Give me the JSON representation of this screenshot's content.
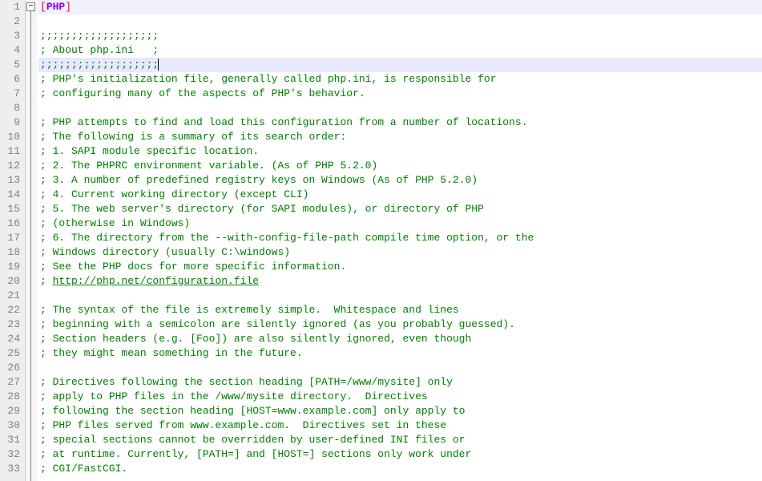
{
  "editor": {
    "fold_marker": "−",
    "current_line": 5,
    "lines": [
      {
        "num": 1,
        "type": "section",
        "text": "[PHP]"
      },
      {
        "num": 2,
        "type": "blank",
        "text": ""
      },
      {
        "num": 3,
        "type": "comment",
        "text": ";;;;;;;;;;;;;;;;;;;"
      },
      {
        "num": 4,
        "type": "comment",
        "text": "; About php.ini   ;"
      },
      {
        "num": 5,
        "type": "comment",
        "text": ";;;;;;;;;;;;;;;;;;;"
      },
      {
        "num": 6,
        "type": "comment",
        "text": "; PHP's initialization file, generally called php.ini, is responsible for"
      },
      {
        "num": 7,
        "type": "comment",
        "text": "; configuring many of the aspects of PHP's behavior."
      },
      {
        "num": 8,
        "type": "blank",
        "text": ""
      },
      {
        "num": 9,
        "type": "comment",
        "text": "; PHP attempts to find and load this configuration from a number of locations."
      },
      {
        "num": 10,
        "type": "comment",
        "text": "; The following is a summary of its search order:"
      },
      {
        "num": 11,
        "type": "comment",
        "text": "; 1. SAPI module specific location."
      },
      {
        "num": 12,
        "type": "comment",
        "text": "; 2. The PHPRC environment variable. (As of PHP 5.2.0)"
      },
      {
        "num": 13,
        "type": "comment",
        "text": "; 3. A number of predefined registry keys on Windows (As of PHP 5.2.0)"
      },
      {
        "num": 14,
        "type": "comment",
        "text": "; 4. Current working directory (except CLI)"
      },
      {
        "num": 15,
        "type": "comment",
        "text": "; 5. The web server's directory (for SAPI modules), or directory of PHP"
      },
      {
        "num": 16,
        "type": "comment",
        "text": "; (otherwise in Windows)"
      },
      {
        "num": 17,
        "type": "comment",
        "text": "; 6. The directory from the --with-config-file-path compile time option, or the"
      },
      {
        "num": 18,
        "type": "comment",
        "text": "; Windows directory (usually C:\\windows)"
      },
      {
        "num": 19,
        "type": "comment",
        "text": "; See the PHP docs for more specific information."
      },
      {
        "num": 20,
        "type": "comment-link",
        "prefix": "; ",
        "link": "http://php.net/configuration.file"
      },
      {
        "num": 21,
        "type": "blank",
        "text": ""
      },
      {
        "num": 22,
        "type": "comment",
        "text": "; The syntax of the file is extremely simple.  Whitespace and lines"
      },
      {
        "num": 23,
        "type": "comment",
        "text": "; beginning with a semicolon are silently ignored (as you probably guessed)."
      },
      {
        "num": 24,
        "type": "comment",
        "text": "; Section headers (e.g. [Foo]) are also silently ignored, even though"
      },
      {
        "num": 25,
        "type": "comment",
        "text": "; they might mean something in the future."
      },
      {
        "num": 26,
        "type": "blank",
        "text": ""
      },
      {
        "num": 27,
        "type": "comment",
        "text": "; Directives following the section heading [PATH=/www/mysite] only"
      },
      {
        "num": 28,
        "type": "comment",
        "text": "; apply to PHP files in the /www/mysite directory.  Directives"
      },
      {
        "num": 29,
        "type": "comment",
        "text": "; following the section heading [HOST=www.example.com] only apply to"
      },
      {
        "num": 30,
        "type": "comment",
        "text": "; PHP files served from www.example.com.  Directives set in these"
      },
      {
        "num": 31,
        "type": "comment",
        "text": "; special sections cannot be overridden by user-defined INI files or"
      },
      {
        "num": 32,
        "type": "comment",
        "text": "; at runtime. Currently, [PATH=] and [HOST=] sections only work under"
      },
      {
        "num": 33,
        "type": "comment",
        "text": "; CGI/FastCGI."
      }
    ]
  }
}
